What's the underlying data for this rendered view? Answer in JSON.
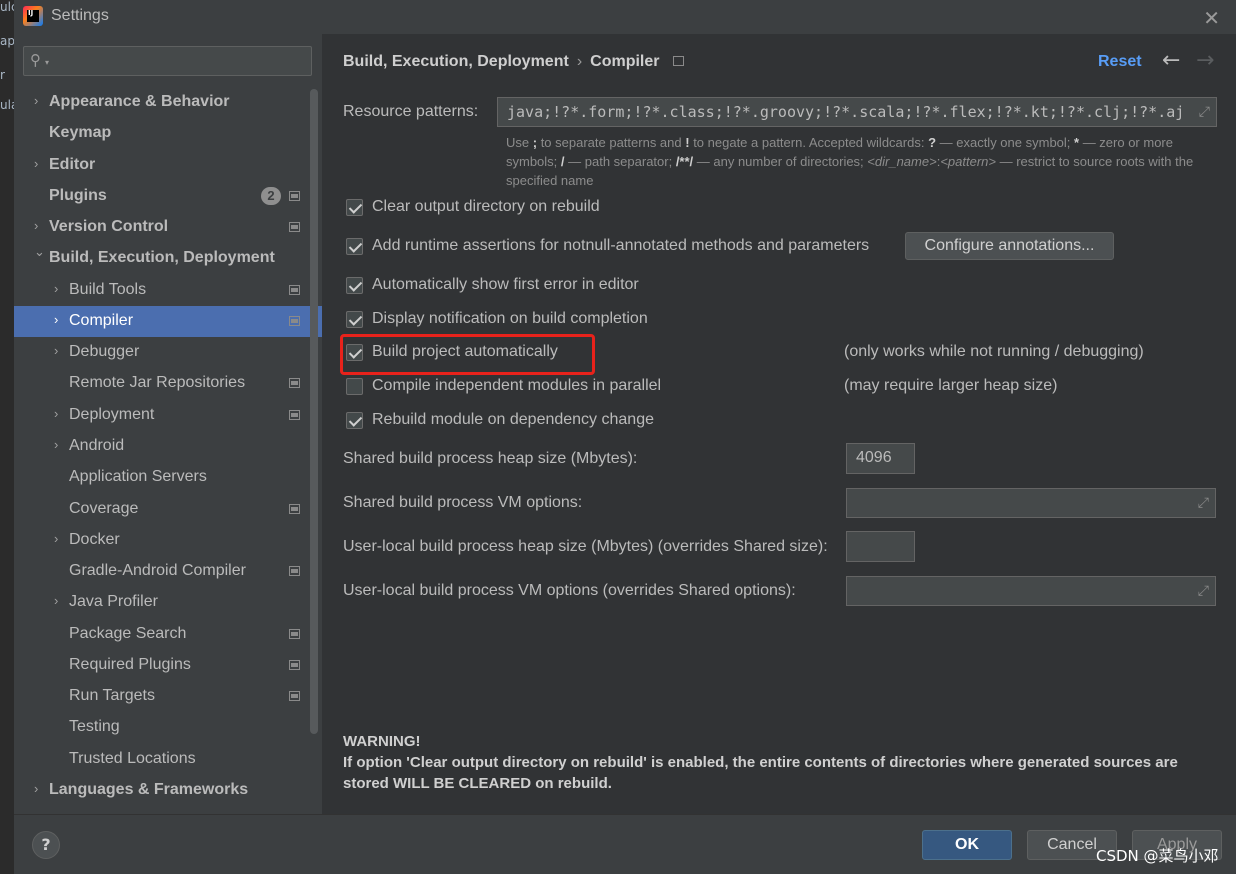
{
  "window": {
    "title": "Settings"
  },
  "behind": {
    "fragments": [
      "ulc",
      "ap",
      "r",
      "ula"
    ]
  },
  "sidebar": {
    "search_placeholder": "",
    "items": [
      {
        "label": "Appearance & Behavior",
        "bold": true,
        "chevron": "›",
        "level": 0
      },
      {
        "label": "Keymap",
        "bold": true,
        "chevron": "",
        "level": 0
      },
      {
        "label": "Editor",
        "bold": true,
        "chevron": "›",
        "level": 0
      },
      {
        "label": "Plugins",
        "bold": true,
        "chevron": "",
        "level": 0,
        "badge": "2",
        "page": true
      },
      {
        "label": "Version Control",
        "bold": true,
        "chevron": "›",
        "level": 0,
        "page": true
      },
      {
        "label": "Build, Execution, Deployment",
        "bold": true,
        "chevron": "⌄",
        "level": 0
      },
      {
        "label": "Build Tools",
        "chevron": "›",
        "level": 1,
        "page": true
      },
      {
        "label": "Compiler",
        "chevron": "›",
        "level": 1,
        "page": true,
        "selected": true
      },
      {
        "label": "Debugger",
        "chevron": "›",
        "level": 1
      },
      {
        "label": "Remote Jar Repositories",
        "chevron": "",
        "level": 1,
        "page": true
      },
      {
        "label": "Deployment",
        "chevron": "›",
        "level": 1,
        "page": true
      },
      {
        "label": "Android",
        "chevron": "›",
        "level": 1
      },
      {
        "label": "Application Servers",
        "chevron": "",
        "level": 1
      },
      {
        "label": "Coverage",
        "chevron": "",
        "level": 1,
        "page": true
      },
      {
        "label": "Docker",
        "chevron": "›",
        "level": 1
      },
      {
        "label": "Gradle-Android Compiler",
        "chevron": "",
        "level": 1,
        "page": true
      },
      {
        "label": "Java Profiler",
        "chevron": "›",
        "level": 1
      },
      {
        "label": "Package Search",
        "chevron": "",
        "level": 1,
        "page": true
      },
      {
        "label": "Required Plugins",
        "chevron": "",
        "level": 1,
        "page": true
      },
      {
        "label": "Run Targets",
        "chevron": "",
        "level": 1,
        "page": true
      },
      {
        "label": "Testing",
        "chevron": "",
        "level": 1
      },
      {
        "label": "Trusted Locations",
        "chevron": "",
        "level": 1
      },
      {
        "label": "Languages & Frameworks",
        "bold": true,
        "chevron": "›",
        "level": 0
      }
    ]
  },
  "header": {
    "crumb_parent": "Build, Execution, Deployment",
    "crumb_sep": "›",
    "crumb_current": "Compiler",
    "reset": "Reset",
    "back": "←",
    "forward": "→"
  },
  "resource": {
    "label": "Resource patterns:",
    "value": "java;!?*.form;!?*.class;!?*.groovy;!?*.scala;!?*.flex;!?*.kt;!?*.clj;!?*.aj",
    "hint": {
      "t1": "Use ",
      "b1": ";",
      "t2": " to separate patterns and ",
      "b2": "!",
      "t3": " to negate a pattern. Accepted wildcards: ",
      "b3": "?",
      "t4": " — exactly one symbol; ",
      "b4": "*",
      "t5": " — zero or more symbols; ",
      "b5": "/",
      "t6": " — path separator; ",
      "b6": "/**/",
      "t7": " — any number of directories; ",
      "i1": "<dir_name>",
      "t8": ":",
      "i2": "<pattern>",
      "t9": " — restrict to source roots with the specified name"
    }
  },
  "options": [
    {
      "label": "Clear output directory on rebuild",
      "checked": true
    },
    {
      "label": "Add runtime assertions for notnull-annotated methods and parameters",
      "checked": true
    },
    {
      "label": "Automatically show first error in editor",
      "checked": true
    },
    {
      "label": "Display notification on build completion",
      "checked": true
    },
    {
      "label": "Build project automatically",
      "checked": true,
      "note": "(only works while not running / debugging)"
    },
    {
      "label": "Compile independent modules in parallel",
      "checked": false,
      "note": "(may require larger heap size)"
    },
    {
      "label": "Rebuild module on dependency change",
      "checked": true
    }
  ],
  "configure_button": "Configure annotations...",
  "fields": {
    "shared_heap_label": "Shared build process heap size (Mbytes):",
    "shared_heap_value": "4096",
    "shared_vm_label": "Shared build process VM options:",
    "shared_vm_value": "",
    "user_heap_label": "User-local build process heap size (Mbytes) (overrides Shared size):",
    "user_heap_value": "",
    "user_vm_label": "User-local build process VM options (overrides Shared options):",
    "user_vm_value": ""
  },
  "warning": {
    "title": "WARNING!",
    "text": "If option 'Clear output directory on rebuild' is enabled, the entire contents of directories where generated sources are stored WILL BE CLEARED on rebuild."
  },
  "footer": {
    "help": "?",
    "ok": "OK",
    "cancel": "Cancel",
    "apply": "Apply",
    "watermark": "CSDN @菜鸟小邓"
  },
  "colors": {
    "accent": "#589df6",
    "selection": "#4b6eaf",
    "highlight_box": "#e8221b",
    "ok_button": "#365880"
  }
}
